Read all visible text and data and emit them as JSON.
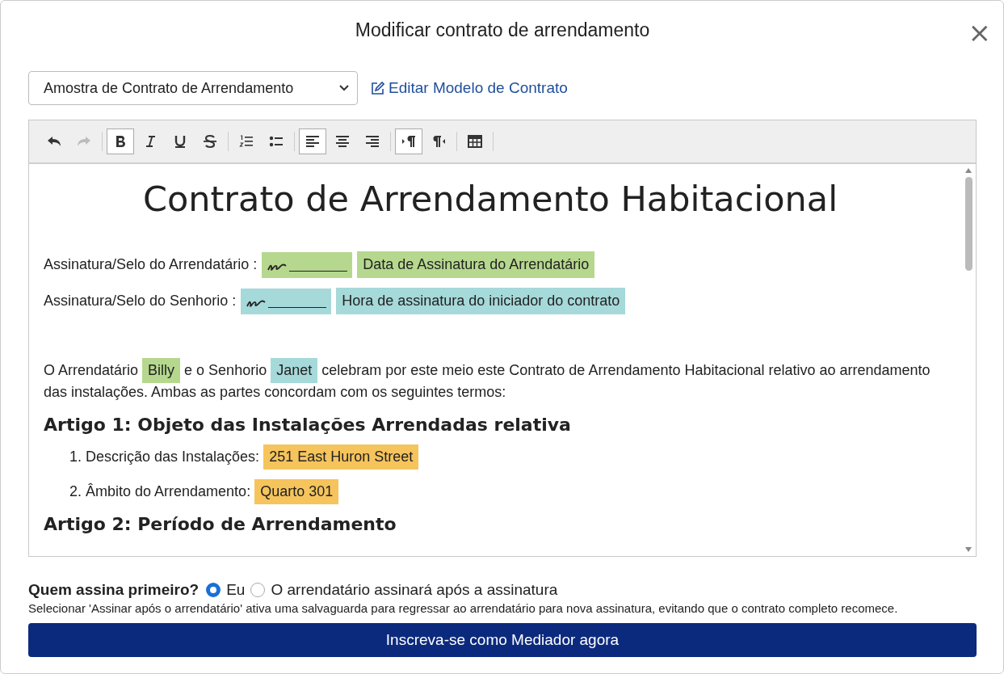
{
  "dialog": {
    "title": "Modificar contrato de arrendamento",
    "close": "×"
  },
  "template_select": {
    "value": "Amostra de Contrato de Arrendamento"
  },
  "edit_template_link": "Editar Modelo de Contrato",
  "toolbar": [
    {
      "kind": "undo",
      "active": false,
      "disabled": false
    },
    {
      "kind": "redo",
      "active": false,
      "disabled": true
    },
    {
      "kind": "bold",
      "active": true,
      "disabled": false
    },
    {
      "kind": "italic",
      "active": false,
      "disabled": false
    },
    {
      "kind": "underline",
      "active": false,
      "disabled": false
    },
    {
      "kind": "strike",
      "active": false,
      "disabled": false
    },
    {
      "kind": "ordered",
      "active": false,
      "disabled": false
    },
    {
      "kind": "bullet",
      "active": false,
      "disabled": false
    },
    {
      "kind": "align-left",
      "active": true,
      "disabled": false
    },
    {
      "kind": "align-center",
      "active": false,
      "disabled": false
    },
    {
      "kind": "align-right",
      "active": false,
      "disabled": false
    },
    {
      "kind": "ltr",
      "active": true,
      "disabled": false
    },
    {
      "kind": "rtl",
      "active": false,
      "disabled": false
    },
    {
      "kind": "table",
      "active": false,
      "disabled": false
    }
  ],
  "document": {
    "title": "Contrato de Arrendamento Habitacional",
    "signature_rows": [
      {
        "label": "Assinatura/Selo do Arrendatário :",
        "field": "Data de Assinatura do Arrendatário",
        "color": "#b6d88e"
      },
      {
        "label": "Assinatura/Selo do Senhorio :",
        "field": "Hora de assinatura do iniciador do contrato",
        "color": "#a6d9d9"
      }
    ],
    "paragraph_lines": [
      [
        {
          "kind": "text",
          "text": "O Arrendatário"
        },
        {
          "kind": "field",
          "text": "Billy",
          "color": "#b6d88e"
        },
        {
          "kind": "text",
          "text": "e o Senhorio"
        },
        {
          "kind": "field",
          "text": "Janet",
          "color": "#a6d9d9"
        },
        {
          "kind": "text",
          "text": "celebram por este meio este Contrato de Arrendamento Habitacional relativo ao arrendamento"
        }
      ],
      [
        {
          "kind": "text",
          "text": "das instalações. Ambas as partes concordam com os seguintes termos:"
        }
      ]
    ],
    "sections": [
      {
        "heading": "Artigo 1: Objeto das Instalações Arrendadas relativa",
        "items": [
          {
            "number": "1.",
            "label": "Descrição das Instalações:",
            "value": "251 East Huron Street",
            "color": "#f6c45c"
          },
          {
            "number": "2.",
            "label": "Âmbito do Arrendamento:",
            "value": "Quarto 301",
            "color": "#f6c45c"
          }
        ]
      },
      {
        "heading": "Artigo 2: Período de Arrendamento"
      }
    ]
  },
  "signing_order": {
    "question": "Quem assina primeiro?",
    "options": [
      {
        "label": "Eu",
        "selected": true
      },
      {
        "label": "O arrendatário assinará após a assinatura",
        "selected": false
      }
    ],
    "note": "Selecionar 'Assinar após o arrendatário' ativa uma salvaguarda para regressar ao arrendatário para nova assinatura, evitando que o contrato completo recomece."
  },
  "submit_button": "Inscreva-se como Mediador agora"
}
